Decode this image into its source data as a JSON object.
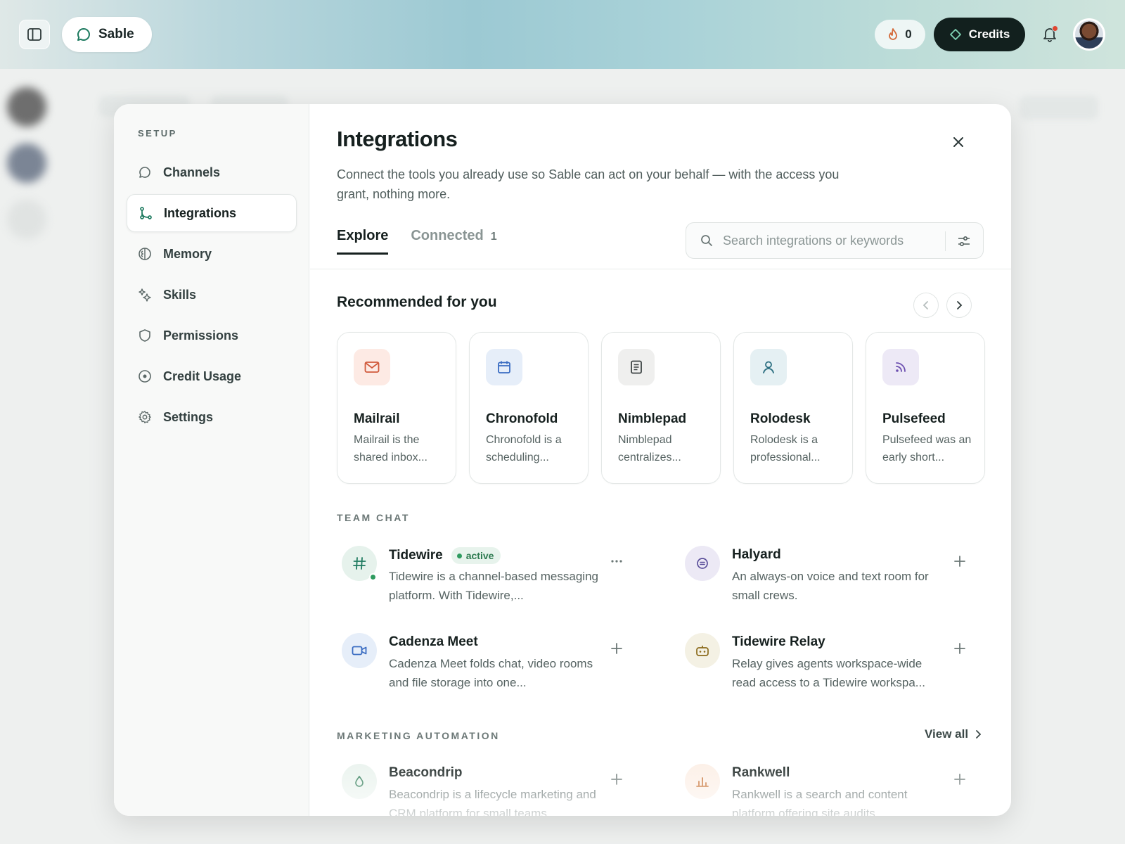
{
  "topbar": {
    "brand": "Sable",
    "streak_count": "0",
    "credits_label": "Credits"
  },
  "sidebar": {
    "heading": "SETUP",
    "items": [
      {
        "label": "Channels",
        "icon": "chat-bubble-icon"
      },
      {
        "label": "Integrations",
        "icon": "branch-icon"
      },
      {
        "label": "Memory",
        "icon": "brain-icon"
      },
      {
        "label": "Skills",
        "icon": "sparkles-icon"
      },
      {
        "label": "Permissions",
        "icon": "shield-icon"
      },
      {
        "label": "Credit Usage",
        "icon": "coin-icon"
      },
      {
        "label": "Settings",
        "icon": "gear-icon"
      }
    ]
  },
  "main": {
    "title": "Integrations",
    "description": "Connect the tools you already use so Sable can act on your behalf — with the access you grant, nothing more.",
    "tabs": [
      {
        "label": "Explore",
        "count": ""
      },
      {
        "label": "Connected",
        "count": "1"
      }
    ],
    "search": {
      "placeholder": "Search integrations or keywords"
    },
    "recommended": {
      "title": "Recommended for you",
      "cards": [
        {
          "name": "Mailrail",
          "desc": "Mailrail is the shared inbox...",
          "icon": "mail-icon",
          "color": "#fdeae4"
        },
        {
          "name": "Chronofold",
          "desc": "Chronofold is a scheduling...",
          "icon": "calendar-icon",
          "color": "#e6eef9"
        },
        {
          "name": "Nimblepad",
          "desc": "Nimblepad centralizes...",
          "icon": "document-icon",
          "color": "#efefee"
        },
        {
          "name": "Rolodesk",
          "desc": "Rolodesk is a professional...",
          "icon": "person-icon",
          "color": "#e5f0f3"
        },
        {
          "name": "Pulsefeed",
          "desc": "Pulsefeed was an early short...",
          "icon": "feed-icon",
          "color": "#ede9f6"
        }
      ]
    },
    "team_chat": {
      "heading": "TEAM CHAT",
      "items": [
        {
          "name": "Tidewire",
          "badge": "active",
          "desc": "Tidewire is a channel-based messaging platform. With Tidewire,...",
          "icon": "hash-icon"
        },
        {
          "name": "Halyard",
          "desc": "An always-on voice and text room for small crews.",
          "icon": "voice-icon"
        },
        {
          "name": "Cadenza Meet",
          "desc": "Cadenza Meet folds chat, video rooms and file storage into one...",
          "icon": "video-icon"
        },
        {
          "name": "Tidewire Relay",
          "desc": "Relay gives agents workspace-wide read access to a Tidewire workspa...",
          "icon": "bot-icon"
        }
      ]
    },
    "marketing": {
      "heading": "MARKETING AUTOMATION",
      "view_all": "View all",
      "items": [
        {
          "name": "Beacondrip",
          "desc": "Beacondrip is a lifecycle marketing and CRM platform for small teams...",
          "icon": "drop-icon"
        },
        {
          "name": "Rankwell",
          "desc": "Rankwell is a search and content platform offering site audits...",
          "icon": "bar-chart-icon"
        }
      ]
    }
  }
}
